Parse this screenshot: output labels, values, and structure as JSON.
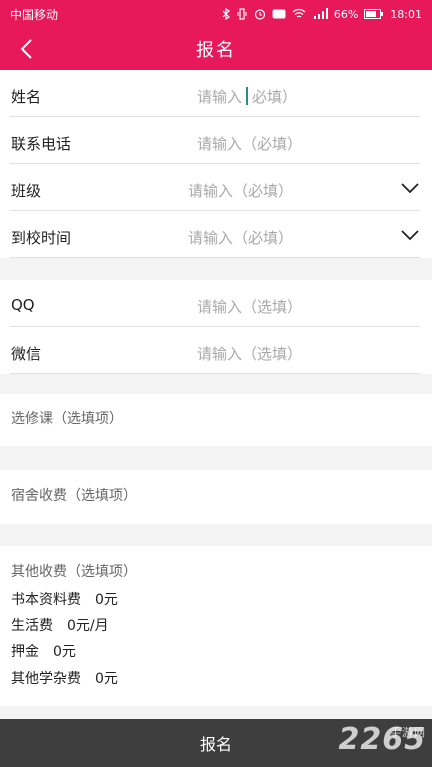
{
  "status_bar": {
    "carrier": "中国移动",
    "battery": "66%",
    "time": "18:01"
  },
  "header": {
    "title": "报名"
  },
  "form": {
    "fields": [
      {
        "label": "姓名",
        "placeholder_left": "请输入",
        "placeholder_right": "必填）"
      },
      {
        "label": "联系电话",
        "placeholder": "请输入（必填）"
      },
      {
        "label": "班级",
        "placeholder": "请输入（必填）"
      },
      {
        "label": "到校时间",
        "placeholder": "请输入（必填）"
      }
    ],
    "optional_fields": [
      {
        "label": "QQ",
        "placeholder": "请输入（选填）"
      },
      {
        "label": "微信",
        "placeholder": "请输入（选填）"
      }
    ]
  },
  "elective": {
    "title": "选修课（选填项）"
  },
  "dorm": {
    "title": "宿舍收费（选填项）"
  },
  "other_fees": {
    "title": "其他收费（选填项）",
    "items": [
      "书本资料费　0元",
      "生活费　0元/月",
      "押金　0元",
      "其他学杂费　0元"
    ]
  },
  "submit": {
    "label": "报名"
  },
  "watermark": {
    "text": "2265",
    "sub": "手游网"
  },
  "colors": {
    "brand": "#e8195a",
    "bottom_bar": "#3e3e3e",
    "cursor": "#2a8f7f"
  }
}
